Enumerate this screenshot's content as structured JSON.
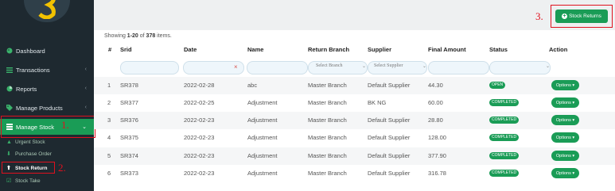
{
  "sidebar": {
    "items": [
      {
        "label": "Dashboard",
        "icon": "palette-icon"
      },
      {
        "label": "Transactions",
        "icon": "list-icon"
      },
      {
        "label": "Reports",
        "icon": "pie-chart-icon"
      },
      {
        "label": "Manage Products",
        "icon": "tag-icon"
      },
      {
        "label": "Manage Stock",
        "icon": "stack-icon"
      }
    ],
    "sub_items": [
      {
        "label": "Urgent Stock",
        "icon": "warning-icon"
      },
      {
        "label": "Purchase Order",
        "icon": "arrow-down-icon"
      },
      {
        "label": "Stock Return",
        "icon": "arrow-up-icon"
      },
      {
        "label": "Stock Take",
        "icon": "checkbox-icon"
      }
    ]
  },
  "annotations": {
    "n1": "1.",
    "n2": "2.",
    "n3": "3."
  },
  "toolbar": {
    "stock_returns_label": "Stock Returns"
  },
  "summary": {
    "prefix": "Showing ",
    "range": "1-20",
    "middle": " of ",
    "total": "378",
    "suffix": " items."
  },
  "table": {
    "headers": [
      "#",
      "Srid",
      "Date",
      "Name",
      "Return Branch",
      "Supplier",
      "Final Amount",
      "Status",
      "Action"
    ],
    "filters": {
      "branch_placeholder": "Select Branch",
      "supplier_placeholder": "Select Supplier",
      "clear_symbol": "×"
    },
    "rows": [
      {
        "n": "1",
        "srid": "SR378",
        "date": "2022-02-28",
        "name": "abc",
        "branch": "Master Branch",
        "supplier": "Default Supplier",
        "amount": "44.30",
        "status": "OPEN",
        "action": "Options ▾"
      },
      {
        "n": "2",
        "srid": "SR377",
        "date": "2022-02-25",
        "name": "Adjustment",
        "branch": "Master Branch",
        "supplier": "BK NG",
        "amount": "60.00",
        "status": "COMPLETED",
        "action": "Options ▾"
      },
      {
        "n": "3",
        "srid": "SR376",
        "date": "2022-02-23",
        "name": "Adjustment",
        "branch": "Master Branch",
        "supplier": "Default Supplier",
        "amount": "28.80",
        "status": "COMPLETED",
        "action": "Options ▾"
      },
      {
        "n": "4",
        "srid": "SR375",
        "date": "2022-02-23",
        "name": "Adjustment",
        "branch": "Master Branch",
        "supplier": "Default Supplier",
        "amount": "128.00",
        "status": "COMPLETED",
        "action": "Options ▾"
      },
      {
        "n": "5",
        "srid": "SR374",
        "date": "2022-02-23",
        "name": "Adjustment",
        "branch": "Master Branch",
        "supplier": "Default Supplier",
        "amount": "377.90",
        "status": "COMPLETED",
        "action": "Options ▾"
      },
      {
        "n": "6",
        "srid": "SR373",
        "date": "2022-02-23",
        "name": "Adjustment",
        "branch": "Master Branch",
        "supplier": "Default Supplier",
        "amount": "316.78",
        "status": "COMPLETED",
        "action": "Options ▾"
      }
    ]
  },
  "colors": {
    "accent": "#1a9c56",
    "sidebar_bg": "#1e2930",
    "annotation": "#e0101e"
  }
}
